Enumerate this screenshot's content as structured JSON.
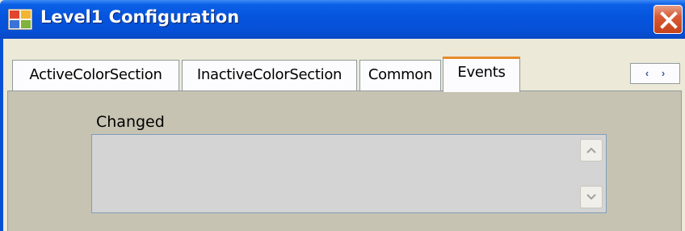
{
  "window": {
    "title": "Level1 Configuration",
    "app_icon": "app-window-icon",
    "close_icon": "close-icon"
  },
  "tabs": [
    {
      "label": "ActiveColorSection",
      "active": false
    },
    {
      "label": "InactiveColorSection",
      "active": false
    },
    {
      "label": "Common",
      "active": false
    },
    {
      "label": "Events",
      "active": true
    }
  ],
  "tab_nav": {
    "prev": "‹",
    "next": "›"
  },
  "events": {
    "changed_label": "Changed",
    "changed_value": ""
  },
  "colors": {
    "titlebar": "#0654dd",
    "active_tab_accent": "#e68b2c",
    "close_button": "#d85a34",
    "panel": "#c7c3b3"
  }
}
